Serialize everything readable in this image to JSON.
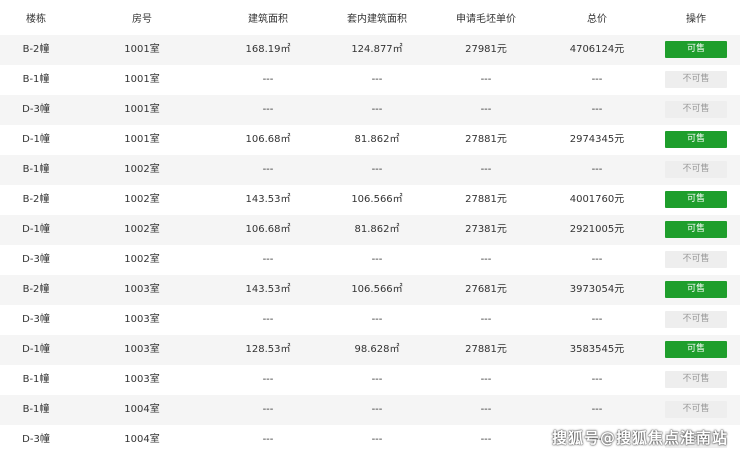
{
  "headers": [
    "楼栋",
    "房号",
    "建筑面积",
    "套内建筑面积",
    "申请毛坯单价",
    "总价",
    "操作"
  ],
  "rows": [
    [
      "B-2幢",
      "1001室",
      "168.19㎡",
      "124.877㎡",
      "27981元",
      "4706124元",
      "可售"
    ],
    [
      "B-1幢",
      "1001室",
      "---",
      "---",
      "---",
      "---",
      "不可售"
    ],
    [
      "D-3幢",
      "1001室",
      "---",
      "---",
      "---",
      "---",
      "不可售"
    ],
    [
      "D-1幢",
      "1001室",
      "106.68㎡",
      "81.862㎡",
      "27881元",
      "2974345元",
      "可售"
    ],
    [
      "B-1幢",
      "1002室",
      "---",
      "---",
      "---",
      "---",
      "不可售"
    ],
    [
      "B-2幢",
      "1002室",
      "143.53㎡",
      "106.566㎡",
      "27881元",
      "4001760元",
      "可售"
    ],
    [
      "D-1幢",
      "1002室",
      "106.68㎡",
      "81.862㎡",
      "27381元",
      "2921005元",
      "可售"
    ],
    [
      "D-3幢",
      "1002室",
      "---",
      "---",
      "---",
      "---",
      "不可售"
    ],
    [
      "B-2幢",
      "1003室",
      "143.53㎡",
      "106.566㎡",
      "27681元",
      "3973054元",
      "可售"
    ],
    [
      "D-3幢",
      "1003室",
      "---",
      "---",
      "---",
      "---",
      "不可售"
    ],
    [
      "D-1幢",
      "1003室",
      "128.53㎡",
      "98.628㎡",
      "27881元",
      "3583545元",
      "可售"
    ],
    [
      "B-1幢",
      "1003室",
      "---",
      "---",
      "---",
      "---",
      "不可售"
    ],
    [
      "B-1幢",
      "1004室",
      "---",
      "---",
      "---",
      "---",
      "不可售"
    ],
    [
      "D-3幢",
      "1004室",
      "---",
      "---",
      "---",
      "---",
      "不可售"
    ]
  ],
  "colors": {
    "available_badge": "#1e9e2c",
    "sold_badge": "#eeeeee",
    "zebra_row": "#f5f5f5"
  },
  "watermark": "搜狐号@搜狐焦点淮南站"
}
